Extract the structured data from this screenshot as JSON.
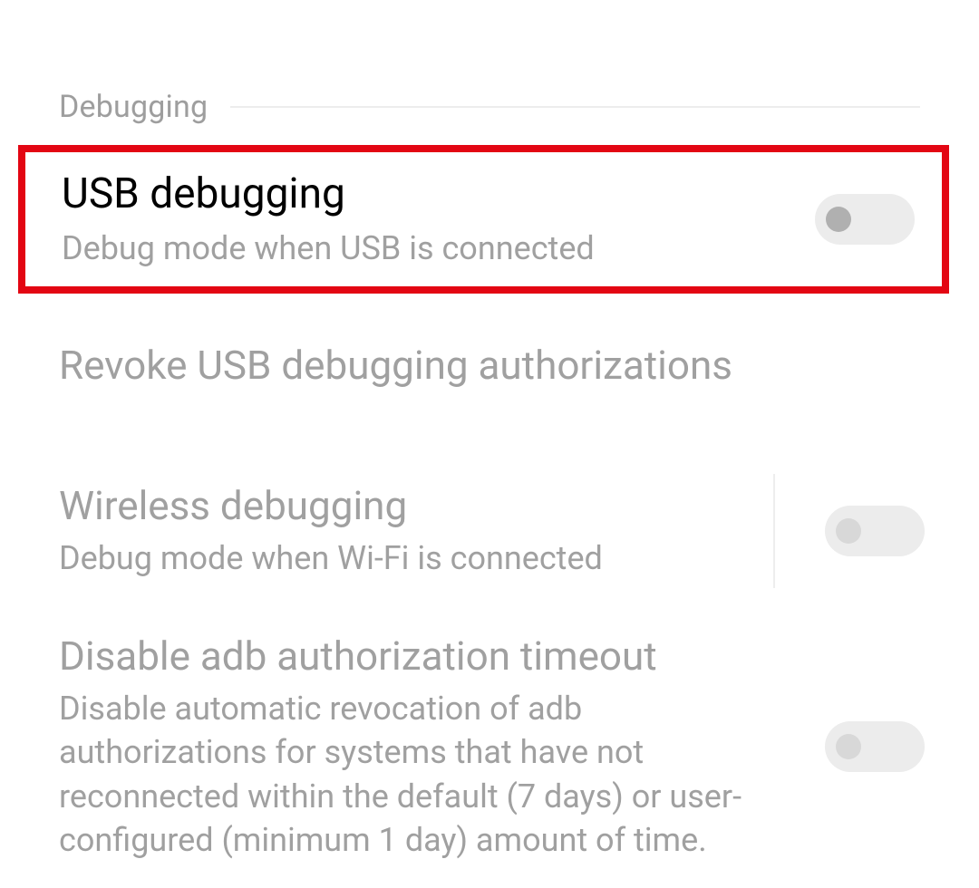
{
  "section": {
    "header": "Debugging"
  },
  "settings": {
    "usb_debugging": {
      "title": "USB debugging",
      "desc": "Debug mode when USB is connected",
      "enabled": false
    },
    "revoke": {
      "title": "Revoke USB debugging authorizations"
    },
    "wireless_debugging": {
      "title": "Wireless debugging",
      "desc": "Debug mode when Wi-Fi is connected",
      "enabled": false
    },
    "disable_adb_timeout": {
      "title": "Disable adb authorization timeout",
      "desc": "Disable automatic revocation of adb authorizations for systems that have not reconnected within the default (7 days) or user-configured (minimum 1 day) amount of time.",
      "enabled": false
    }
  }
}
